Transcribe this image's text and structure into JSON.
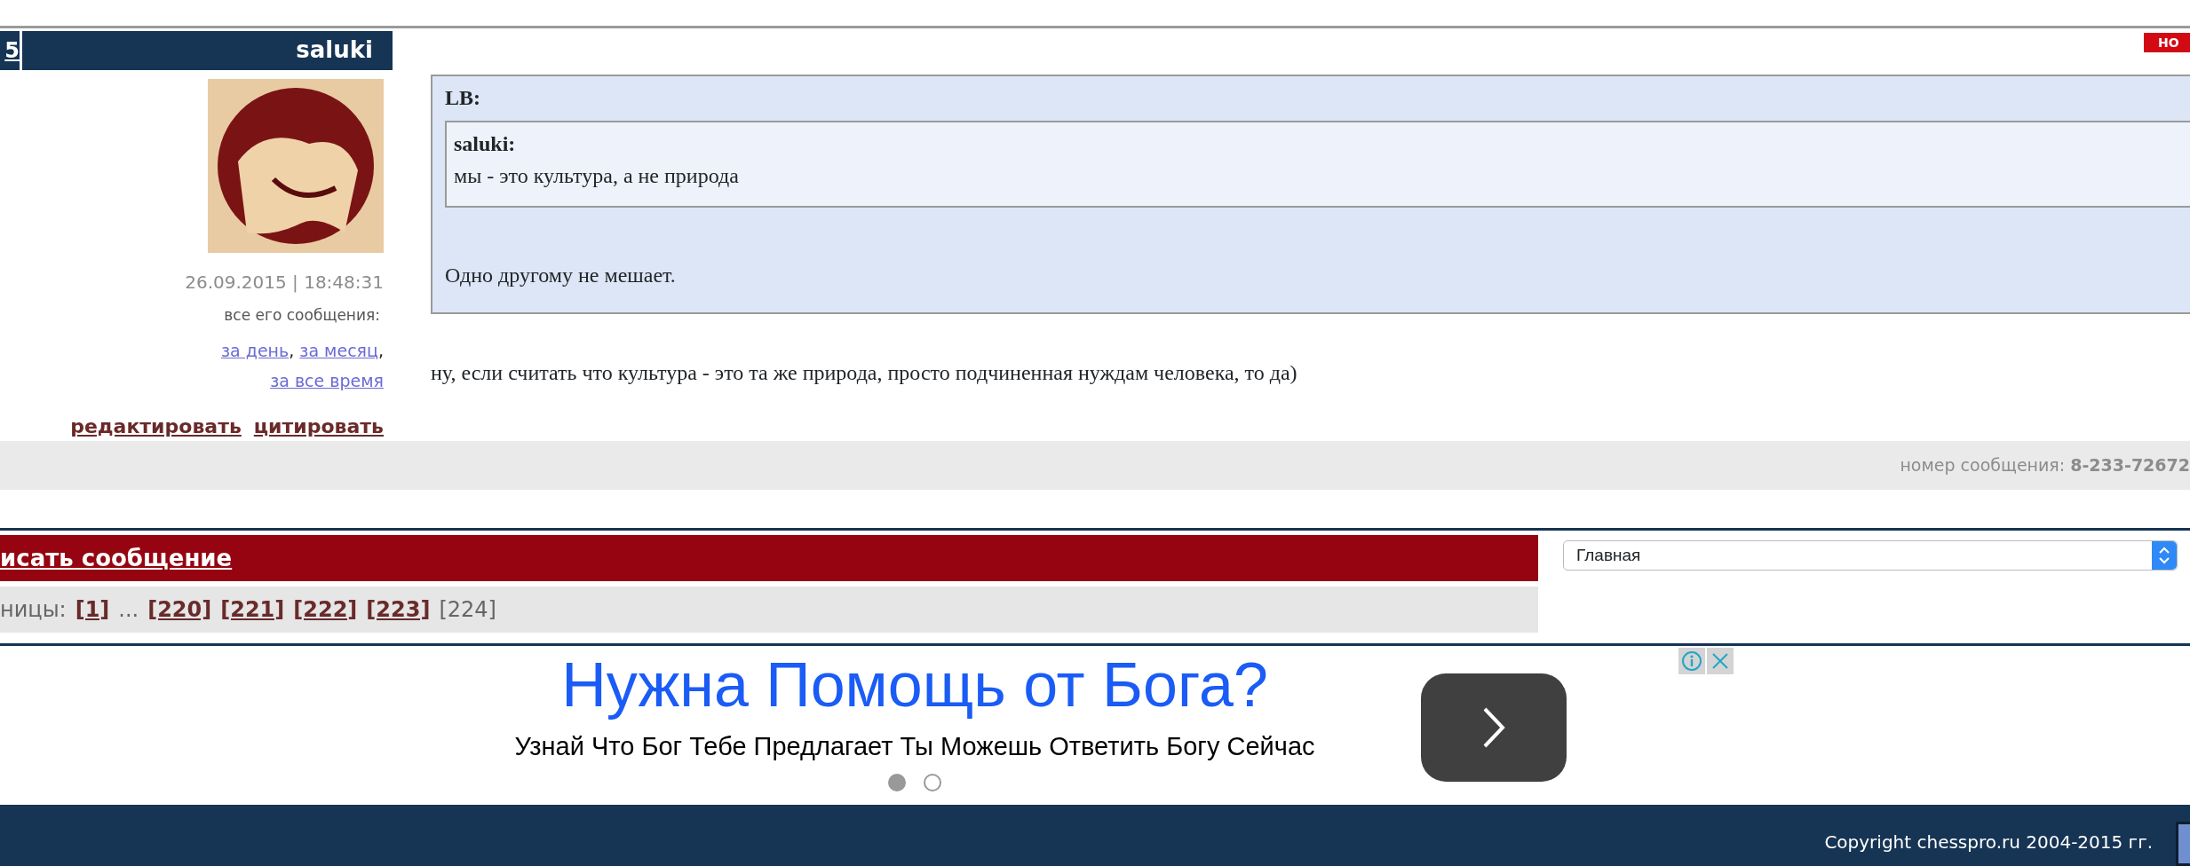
{
  "post": {
    "left_cell": "5",
    "author": "saluki",
    "badge": "НО",
    "timestamp": "26.09.2015 | 18:48:31",
    "all_messages_label": "все его сообщения:",
    "period_links": [
      {
        "label": "за день",
        "suffix": ","
      },
      {
        "label": "за месяц",
        "suffix": ","
      },
      {
        "label": "за все время"
      }
    ],
    "actions": [
      "редактировать",
      "цитировать"
    ],
    "quote": {
      "author": "LB:",
      "nested_quote": {
        "author": "saluki:",
        "text": "мы - это культура, а не природа"
      },
      "text": "Одно другому не мешает."
    },
    "body": "ну, если считать что культура - это та же природа, просто подчиненная нуждам человека, то да)",
    "number_label": "номер сообщения:",
    "number": "8-233-72672"
  },
  "write_message": "исать сообщение",
  "pager": {
    "label": "ницы:",
    "pages": [
      {
        "kind": "page",
        "label": "[1]",
        "selected": false
      },
      {
        "kind": "gap",
        "label": "..."
      },
      {
        "kind": "page",
        "label": "[220]",
        "selected": false
      },
      {
        "kind": "page",
        "label": "[221]",
        "selected": false
      },
      {
        "kind": "page",
        "label": "[222]",
        "selected": false
      },
      {
        "kind": "page",
        "label": "[223]",
        "selected": false
      },
      {
        "kind": "page",
        "label": "[224]",
        "selected": true
      }
    ]
  },
  "nav_select": {
    "value": "Главная"
  },
  "ad": {
    "headline": "Нужна Помощь от Бога?",
    "text": "Узнай Что Бог Тебе Предлагает Ты Можешь Ответить Богу Сейчас",
    "dots": [
      {
        "selected": true
      },
      {
        "selected": false
      }
    ]
  },
  "footer": "Copyright chesspro.ru 2004-2015 гг."
}
